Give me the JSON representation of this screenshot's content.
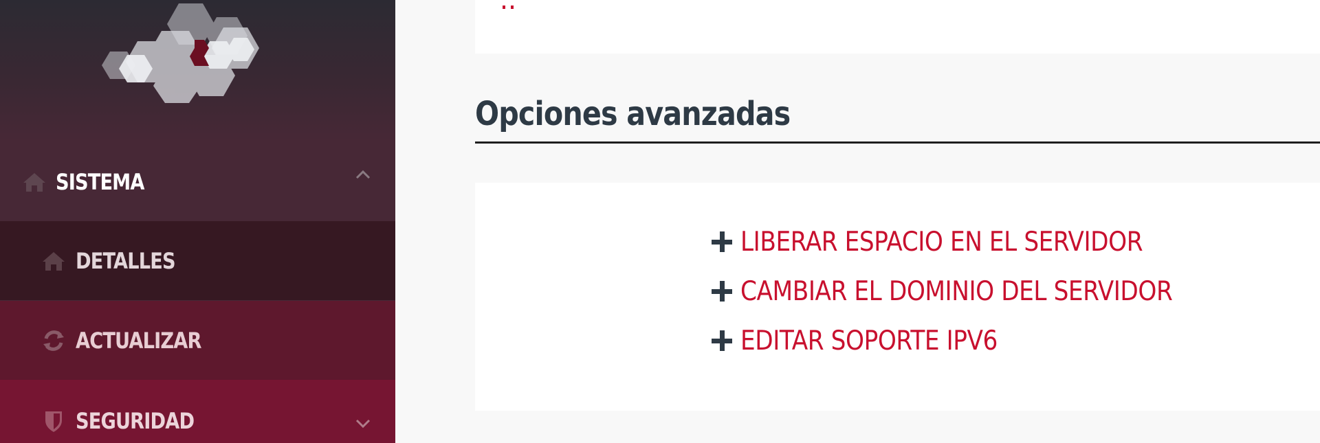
{
  "sidebar": {
    "logo_icon": "hexagon-cloud-logo",
    "items": [
      {
        "label": "SISTEMA",
        "icon": "home-icon",
        "expanded": true
      },
      {
        "label": "DETALLES",
        "icon": "home-icon"
      },
      {
        "label": "ACTUALIZAR",
        "icon": "refresh-icon"
      },
      {
        "label": "SEGURIDAD",
        "icon": "shield-icon",
        "expanded": false
      }
    ]
  },
  "main": {
    "section_title": "Opciones avanzadas",
    "options": [
      {
        "label": "LIBERAR ESPACIO EN EL SERVIDOR",
        "icon": "plus-icon"
      },
      {
        "label": "CAMBIAR EL DOMINIO DEL SERVIDOR",
        "icon": "plus-icon"
      },
      {
        "label": "EDITAR SOPORTE IPV6",
        "icon": "plus-icon"
      }
    ]
  },
  "colors": {
    "accent_red": "#c8102e",
    "heading": "#2e3a45",
    "sidebar_dark": "#2c2a33",
    "sidebar_wine": "#761532"
  }
}
